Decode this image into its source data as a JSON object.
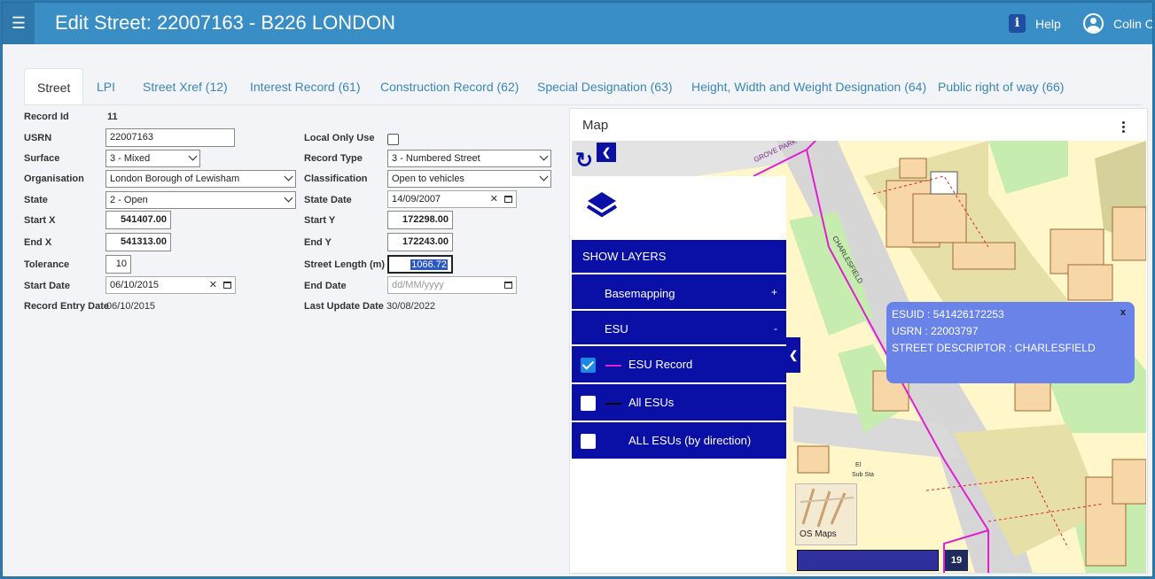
{
  "header": {
    "title": "Edit Street: 22007163 - B226 LONDON",
    "help_label": "Help",
    "user_name": "Colin Or"
  },
  "tabs": [
    {
      "label": "Street"
    },
    {
      "label": "LPI"
    },
    {
      "label": "Street Xref (12)"
    },
    {
      "label": "Interest Record (61)"
    },
    {
      "label": "Construction Record (62)"
    },
    {
      "label": "Special Designation (63)"
    },
    {
      "label": "Height, Width and Weight Designation (64)"
    },
    {
      "label": "Public right of way (66)"
    }
  ],
  "form": {
    "record_id": {
      "label": "Record Id",
      "value": "11"
    },
    "usrn": {
      "label": "USRN",
      "value": "22007163"
    },
    "surface": {
      "label": "Surface",
      "value": "3 - Mixed"
    },
    "organisation": {
      "label": "Organisation",
      "value": "London Borough of Lewisham"
    },
    "state": {
      "label": "State",
      "value": "2 - Open"
    },
    "start_x": {
      "label": "Start X",
      "value": "541407.00"
    },
    "end_x": {
      "label": "End X",
      "value": "541313.00"
    },
    "tolerance": {
      "label": "Tolerance",
      "value": "10"
    },
    "start_date": {
      "label": "Start Date",
      "value": "06/10/2015"
    },
    "record_entry_date": {
      "label": "Record Entry Date",
      "value": "06/10/2015"
    },
    "local_only_use": {
      "label": "Local Only Use",
      "checked": false
    },
    "record_type": {
      "label": "Record Type",
      "value": "3 - Numbered Street"
    },
    "classification": {
      "label": "Classification",
      "value": "Open to vehicles"
    },
    "state_date": {
      "label": "State Date",
      "value": "14/09/2007"
    },
    "start_y": {
      "label": "Start Y",
      "value": "172298.00"
    },
    "end_y": {
      "label": "End Y",
      "value": "172243.00"
    },
    "street_length": {
      "label": "Street Length (m)",
      "value": "1066.72"
    },
    "end_date": {
      "label": "End Date",
      "placeholder": "dd/MM/yyyy"
    },
    "last_update_date": {
      "label": "Last Update Date",
      "value": "30/08/2022"
    }
  },
  "map": {
    "title": "Map",
    "show_layers": "SHOW LAYERS",
    "groups": [
      {
        "label": "Basemapping",
        "sign": "+"
      },
      {
        "label": "ESU",
        "sign": "-"
      }
    ],
    "layers": [
      {
        "label": "ESU Record",
        "checked": true,
        "color": "#e020d0"
      },
      {
        "label": "All ESUs",
        "checked": false,
        "color": "#000000"
      },
      {
        "label": "ALL ESUs (by direction)",
        "checked": false,
        "color": ""
      }
    ],
    "popup": {
      "esuid": "ESUID : 541426172253",
      "usrn": "USRN : 22003797",
      "street": "STREET DESCRIPTOR : CHARLESFIELD",
      "close": "x"
    },
    "street_labels": {
      "grove": "GROVE PARK",
      "charlesfield": "CHARLESFIELD",
      "sub_sta": "Sub Sta",
      "el": "El"
    },
    "basemap_label": "OS Maps",
    "zoom_level": "19"
  },
  "colors": {
    "header": "#3a8ec6",
    "layer_panel": "#0a0fa5",
    "popup": "#6a83e8",
    "esu_line": "#e020d0"
  }
}
